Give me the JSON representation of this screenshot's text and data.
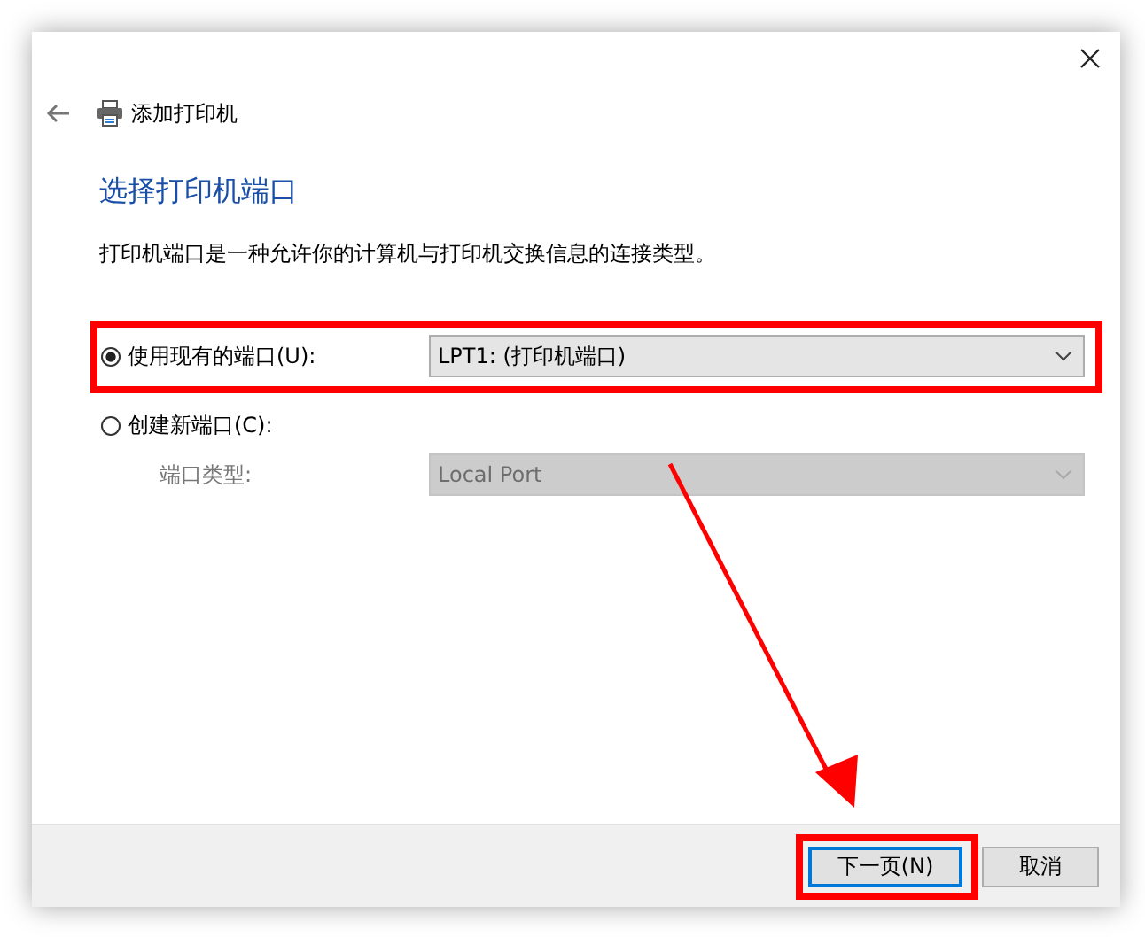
{
  "window": {
    "title": "添加打印机"
  },
  "heading": "选择打印机端口",
  "description": "打印机端口是一种允许你的计算机与打印机交换信息的连接类型。",
  "options": [
    {
      "label": "使用现有的端口(U):",
      "selected": true,
      "combo": "LPT1: (打印机端口)",
      "disabled": false
    },
    {
      "label": "创建新端口(C):",
      "selected": false
    }
  ],
  "port_type": {
    "label": "端口类型:",
    "value": "Local Port",
    "disabled": true
  },
  "buttons": [
    {
      "label": "下一页(N)",
      "default": true
    },
    {
      "label": "取消",
      "default": false
    }
  ]
}
